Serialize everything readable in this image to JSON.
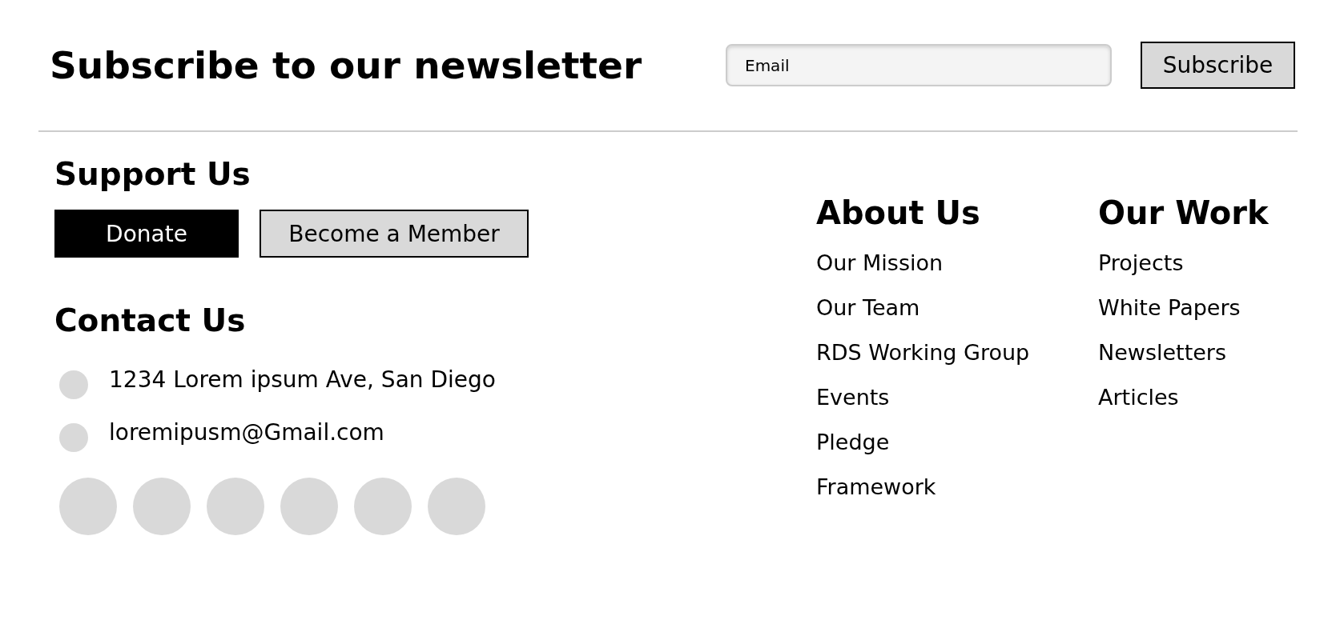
{
  "newsletter": {
    "title": "Subscribe to our newsletter",
    "email": {
      "placeholder": "Email"
    },
    "button": "Subscribe"
  },
  "support": {
    "title": "Support Us",
    "buttons": [
      {
        "label": "Donate",
        "kind": "primary"
      },
      {
        "label": "Become a Member",
        "kind": "secondary"
      }
    ]
  },
  "contact": {
    "title": "Contact Us",
    "items": [
      "1234 Lorem ipsum Ave, San Diego",
      "loremipusm@Gmail.com"
    ]
  },
  "columns": [
    {
      "title": "About Us",
      "links": [
        "Our Mission",
        "Our Team",
        "RDS Working Group",
        "Events",
        "Pledge",
        "Framework"
      ]
    },
    {
      "title": "Our Work",
      "links": [
        "Projects",
        "White Papers",
        "Newsletters",
        "Articles"
      ]
    }
  ]
}
